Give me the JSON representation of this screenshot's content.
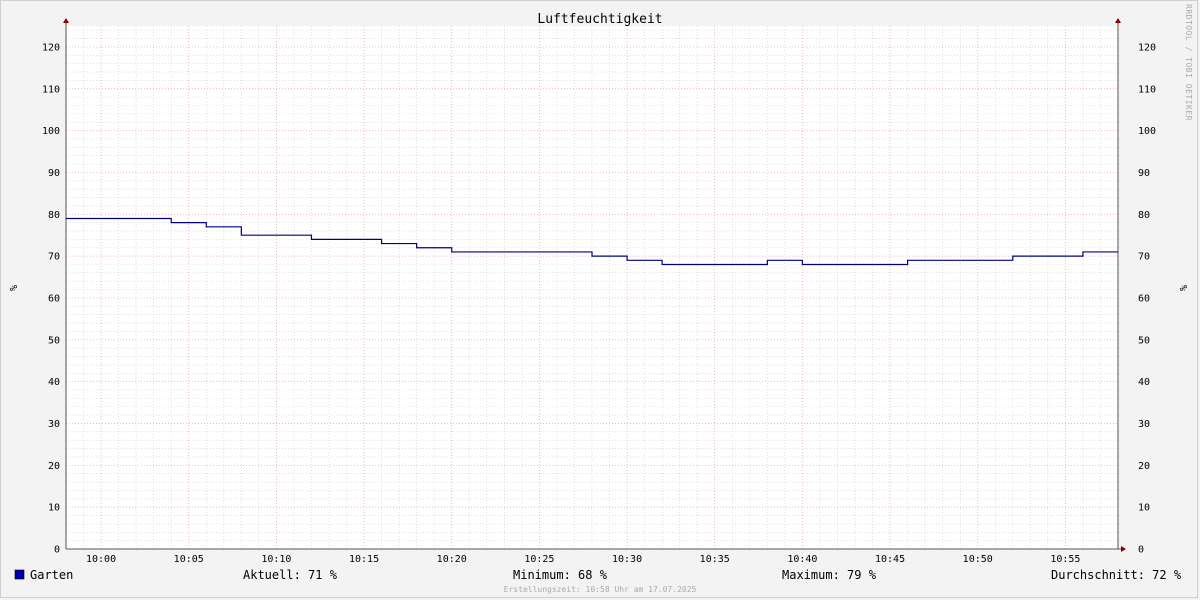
{
  "chart_data": {
    "type": "line",
    "title": "Luftfeuchtigkeit",
    "ylabel": "%",
    "ylim": [
      0,
      125
    ],
    "y_ticks": [
      0,
      10,
      20,
      30,
      40,
      50,
      60,
      70,
      80,
      90,
      100,
      110,
      120
    ],
    "x_range": [
      "09:58",
      "10:58"
    ],
    "x_ticks": [
      "10:00",
      "10:05",
      "10:10",
      "10:15",
      "10:20",
      "10:25",
      "10:30",
      "10:35",
      "10:40",
      "10:45",
      "10:50",
      "10:55"
    ],
    "grid": true,
    "legend_position": "bottom-left",
    "series": [
      {
        "name": "Garten",
        "color": "#000080",
        "legend_color": "#0000aa",
        "points": [
          {
            "x": "09:58",
            "y": 79
          },
          {
            "x": "10:04",
            "y": 78
          },
          {
            "x": "10:06",
            "y": 77
          },
          {
            "x": "10:08",
            "y": 75
          },
          {
            "x": "10:12",
            "y": 74
          },
          {
            "x": "10:16",
            "y": 73
          },
          {
            "x": "10:18",
            "y": 72
          },
          {
            "x": "10:20",
            "y": 71
          },
          {
            "x": "10:28",
            "y": 70
          },
          {
            "x": "10:30",
            "y": 69
          },
          {
            "x": "10:32",
            "y": 68
          },
          {
            "x": "10:38",
            "y": 69
          },
          {
            "x": "10:40",
            "y": 68
          },
          {
            "x": "10:46",
            "y": 69
          },
          {
            "x": "10:52",
            "y": 70
          },
          {
            "x": "10:56",
            "y": 71
          },
          {
            "x": "10:58",
            "y": 71
          }
        ]
      }
    ],
    "stats": [
      {
        "label": "Aktuell:",
        "value": "71 %"
      },
      {
        "label": "Minimum:",
        "value": "68 %"
      },
      {
        "label": "Maximum:",
        "value": "79 %"
      },
      {
        "label": "Durchschnitt:",
        "value": "72 %"
      }
    ],
    "watermark": "RRDTOOL / TOBI OETIKER",
    "footer": "Erstellungszeit: 10:58 Uhr am 17.07.2025"
  },
  "colors": {
    "background": "#f3f3f3",
    "plot_background": "#ffffff",
    "major_grid": "#e8a0a0",
    "minor_grid": "#cccccc",
    "axis": "#555555",
    "arrow": "#8b0000"
  }
}
